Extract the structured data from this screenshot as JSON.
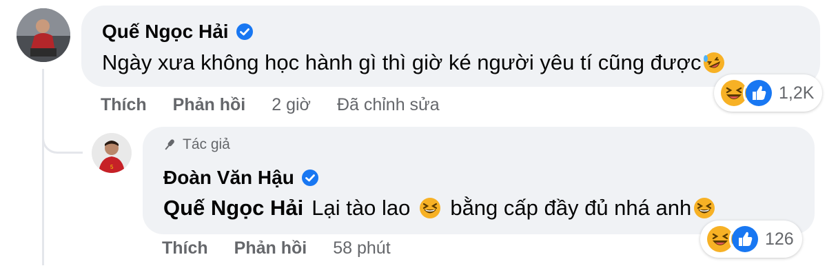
{
  "comment": {
    "author": "Quế Ngọc Hải",
    "text": "Ngày xưa không học hành gì thì giờ ké người yêu tí cũng được",
    "trailing_emoji": "rolling-on-floor-laughing",
    "reactions": {
      "types": [
        "haha",
        "like"
      ],
      "count": "1,2K"
    },
    "actions": {
      "like": "Thích",
      "reply": "Phản hồi",
      "time": "2 giờ",
      "edited": "Đã chỉnh sửa"
    }
  },
  "reply": {
    "badge": "Tác giả",
    "author": "Đoàn Văn Hậu",
    "mention": "Quế Ngọc Hải",
    "text_part1": "Lại tào lao",
    "text_part2": "bằng cấp đầy đủ nhá anh",
    "emojis": [
      "grinning-squinting",
      "grinning-squinting"
    ],
    "reactions": {
      "types": [
        "haha",
        "like"
      ],
      "count": "126"
    },
    "actions": {
      "like": "Thích",
      "reply": "Phản hồi",
      "time": "58 phút"
    }
  },
  "colors": {
    "bubble": "#f0f2f5",
    "verified": "#1877f2",
    "muted_text": "#65676b",
    "like_blue": "#1877f2",
    "haha_yellow": "#f7b125"
  }
}
